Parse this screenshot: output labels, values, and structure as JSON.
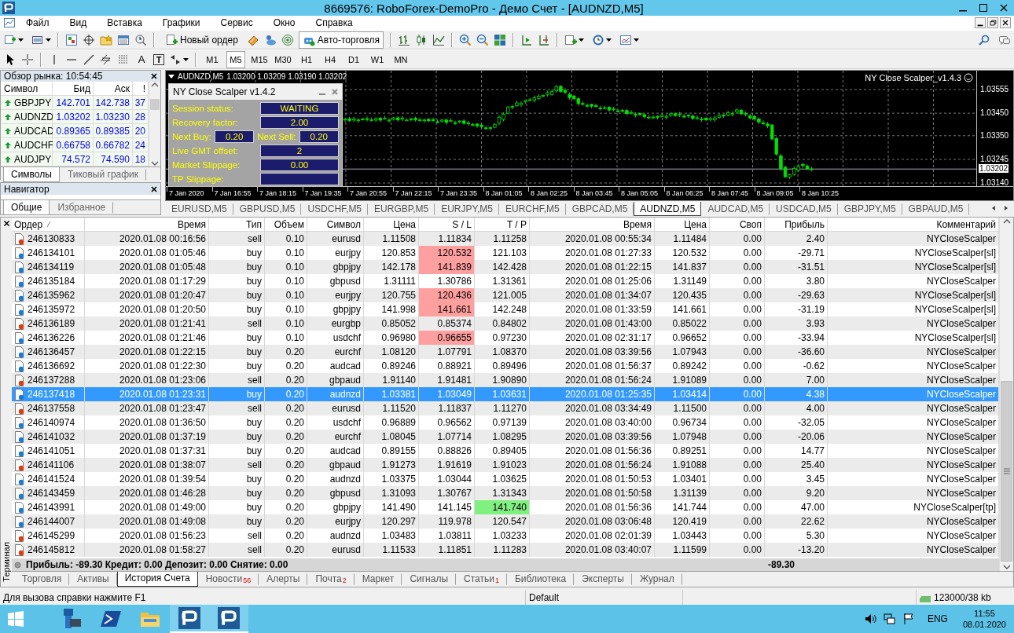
{
  "window": {
    "title": "8669576: RoboForex-DemoPro - Демо Счет - [AUDNZD,M5]"
  },
  "menu": [
    "Файл",
    "Вид",
    "Вставка",
    "Графики",
    "Сервис",
    "Окно",
    "Справка"
  ],
  "toolbar": {
    "new_order": "Новый ордер",
    "autotrading": {
      "label": "Авто-торговля",
      "on": true
    }
  },
  "drawing_tools": {
    "text_tool": "A",
    "text_label_tool": "T"
  },
  "timeframes": [
    {
      "label": "M1",
      "selected": false
    },
    {
      "label": "M5",
      "selected": true
    },
    {
      "label": "M15",
      "selected": false
    },
    {
      "label": "M30",
      "selected": false
    },
    {
      "label": "H1",
      "selected": false
    },
    {
      "label": "H4",
      "selected": false
    },
    {
      "label": "D1",
      "selected": false
    },
    {
      "label": "W1",
      "selected": false
    },
    {
      "label": "MN",
      "selected": false
    }
  ],
  "market_watch": {
    "title": "Обзор рынка: 10:54:45",
    "columns": [
      "Символ",
      "Бид",
      "Аск",
      "!"
    ],
    "rows": [
      {
        "symbol": "GBPJPY",
        "bid": "142.701",
        "ask": "142.738",
        "spread": "37"
      },
      {
        "symbol": "AUDNZD",
        "bid": "1.03202",
        "ask": "1.03230",
        "spread": "28"
      },
      {
        "symbol": "AUDCAD",
        "bid": "0.89365",
        "ask": "0.89385",
        "spread": "20"
      },
      {
        "symbol": "AUDCHF",
        "bid": "0.66758",
        "ask": "0.66782",
        "spread": "24"
      },
      {
        "symbol": "AUDJPY",
        "bid": "74.572",
        "ask": "74.590",
        "spread": "18"
      }
    ],
    "tabs": [
      {
        "label": "Символы",
        "selected": true
      },
      {
        "label": "Тиковый график",
        "selected": false
      }
    ]
  },
  "navigator": {
    "title": "Навигатор",
    "tabs": [
      {
        "label": "Общие",
        "selected": true
      },
      {
        "label": "Избранное",
        "selected": false
      }
    ]
  },
  "chart": {
    "symbol": "AUDNZD,M5",
    "ohlc": "1.03200 1.03209 1.03190 1.03202",
    "expert": "NY Close Scalper_v1.4.3",
    "price_labels": [
      "1.03555",
      "1.03450",
      "1.03350",
      "1.03245",
      "1.03140"
    ],
    "current_price": "1.03202",
    "time_labels": [
      "7 Jan 2020",
      "7 Jan 16:55",
      "7 Jan 18:15",
      "7 Jan 19:35",
      "7 Jan 20:55",
      "7 Jan 22:15",
      "7 Jan 23:35",
      "8 Jan 01:05",
      "8 Jan 02:25",
      "8 Jan 03:45",
      "8 Jan 05:05",
      "8 Jan 06:25",
      "8 Jan 07:45",
      "8 Jan 09:05",
      "8 Jan 10:25"
    ],
    "panel": {
      "title": "NY Close Scalper v1.4.2",
      "rows": [
        {
          "kind": "single",
          "label": "Session status:",
          "value": "WAITING"
        },
        {
          "kind": "single",
          "label": "Recovery factor:",
          "value": "2.00"
        },
        {
          "kind": "pair",
          "label": "Next Buy:",
          "value": "0.20",
          "label2": "Next Sell:",
          "value2": "0.20"
        },
        {
          "kind": "single",
          "label": "Live GMT offset:",
          "value": "2"
        },
        {
          "kind": "single",
          "label": "Market Slippage:",
          "value": "0.00"
        },
        {
          "kind": "single",
          "label": "TP Slippage:"
        }
      ]
    }
  },
  "chart_tabs": [
    {
      "label": "EURUSD,M5",
      "selected": false
    },
    {
      "label": "GBPUSD,M5",
      "selected": false
    },
    {
      "label": "USDCHF,M5",
      "selected": false
    },
    {
      "label": "EURGBP,M5",
      "selected": false
    },
    {
      "label": "EURJPY,M5",
      "selected": false
    },
    {
      "label": "EURCHF,M5",
      "selected": false
    },
    {
      "label": "GBPCAD,M5",
      "selected": false
    },
    {
      "label": "AUDNZD,M5",
      "selected": true
    },
    {
      "label": "AUDCAD,M5",
      "selected": false
    },
    {
      "label": "USDCAD,M5",
      "selected": false
    },
    {
      "label": "GBPJPY,M5",
      "selected": false
    },
    {
      "label": "GBPAUD,M5",
      "selected": false
    }
  ],
  "terminal": {
    "label": "Терминал",
    "columns": [
      "Ордер",
      "Время",
      "Тип",
      "Объем",
      "Символ",
      "Цена",
      "S / L",
      "T / P",
      "Время",
      "Цена",
      "Своп",
      "Прибыль",
      "Комментарий"
    ],
    "rows": [
      {
        "order": "246130833",
        "kind": "sell",
        "open_time": "2020.01.08 00:16:56",
        "type": "sell",
        "volume": "0.10",
        "symbol": "eurusd",
        "price": "1.11508",
        "sl": "1.11834",
        "tp": "1.11258",
        "close_time": "2020.01.08 00:55:34",
        "close_price": "1.11484",
        "swap": "0.00",
        "profit": "2.40",
        "comment": "NYCloseScalper",
        "sl_hit": false,
        "tp_hit": false,
        "selected": false
      },
      {
        "order": "246134101",
        "kind": "buy",
        "open_time": "2020.01.08 01:05:46",
        "type": "buy",
        "volume": "0.10",
        "symbol": "eurjpy",
        "price": "120.853",
        "sl": "120.532",
        "tp": "121.103",
        "close_time": "2020.01.08 01:27:33",
        "close_price": "120.532",
        "swap": "0.00",
        "profit": "-29.71",
        "comment": "NYCloseScalper[sl]",
        "sl_hit": true,
        "tp_hit": false,
        "selected": false
      },
      {
        "order": "246134119",
        "kind": "buy",
        "open_time": "2020.01.08 01:05:48",
        "type": "buy",
        "volume": "0.10",
        "symbol": "gbpjpy",
        "price": "142.178",
        "sl": "141.839",
        "tp": "142.428",
        "close_time": "2020.01.08 01:22:15",
        "close_price": "141.837",
        "swap": "0.00",
        "profit": "-31.51",
        "comment": "NYCloseScalper[sl]",
        "sl_hit": true,
        "tp_hit": false,
        "selected": false
      },
      {
        "order": "246135184",
        "kind": "buy",
        "open_time": "2020.01.08 01:17:29",
        "type": "buy",
        "volume": "0.10",
        "symbol": "gbpusd",
        "price": "1.31111",
        "sl": "1.30786",
        "tp": "1.31361",
        "close_time": "2020.01.08 01:25:06",
        "close_price": "1.31149",
        "swap": "0.00",
        "profit": "3.80",
        "comment": "NYCloseScalper",
        "sl_hit": false,
        "tp_hit": false,
        "selected": false
      },
      {
        "order": "246135962",
        "kind": "buy",
        "open_time": "2020.01.08 01:20:47",
        "type": "buy",
        "volume": "0.10",
        "symbol": "eurjpy",
        "price": "120.755",
        "sl": "120.436",
        "tp": "121.005",
        "close_time": "2020.01.08 01:34:07",
        "close_price": "120.435",
        "swap": "0.00",
        "profit": "-29.63",
        "comment": "NYCloseScalper[sl]",
        "sl_hit": true,
        "tp_hit": false,
        "selected": false
      },
      {
        "order": "246135972",
        "kind": "buy",
        "open_time": "2020.01.08 01:20:50",
        "type": "buy",
        "volume": "0.10",
        "symbol": "gbpjpy",
        "price": "141.998",
        "sl": "141.661",
        "tp": "142.248",
        "close_time": "2020.01.08 01:33:59",
        "close_price": "141.661",
        "swap": "0.00",
        "profit": "-31.19",
        "comment": "NYCloseScalper[sl]",
        "sl_hit": true,
        "tp_hit": false,
        "selected": false
      },
      {
        "order": "246136189",
        "kind": "sell",
        "open_time": "2020.01.08 01:21:41",
        "type": "sell",
        "volume": "0.10",
        "symbol": "eurgbp",
        "price": "0.85052",
        "sl": "0.85374",
        "tp": "0.84802",
        "close_time": "2020.01.08 01:43:00",
        "close_price": "0.85022",
        "swap": "0.00",
        "profit": "3.93",
        "comment": "NYCloseScalper",
        "sl_hit": false,
        "tp_hit": false,
        "selected": false
      },
      {
        "order": "246136226",
        "kind": "buy",
        "open_time": "2020.01.08 01:21:46",
        "type": "buy",
        "volume": "0.10",
        "symbol": "usdchf",
        "price": "0.96980",
        "sl": "0.96655",
        "tp": "0.97230",
        "close_time": "2020.01.08 02:31:17",
        "close_price": "0.96652",
        "swap": "0.00",
        "profit": "-33.94",
        "comment": "NYCloseScalper[sl]",
        "sl_hit": true,
        "tp_hit": false,
        "selected": false
      },
      {
        "order": "246136457",
        "kind": "buy",
        "open_time": "2020.01.08 01:22:15",
        "type": "buy",
        "volume": "0.20",
        "symbol": "eurchf",
        "price": "1.08120",
        "sl": "1.07791",
        "tp": "1.08370",
        "close_time": "2020.01.08 03:39:56",
        "close_price": "1.07943",
        "swap": "0.00",
        "profit": "-36.60",
        "comment": "NYCloseScalper",
        "sl_hit": false,
        "tp_hit": false,
        "selected": false
      },
      {
        "order": "246136692",
        "kind": "buy",
        "open_time": "2020.01.08 01:22:30",
        "type": "buy",
        "volume": "0.20",
        "symbol": "audcad",
        "price": "0.89246",
        "sl": "0.88921",
        "tp": "0.89496",
        "close_time": "2020.01.08 01:56:37",
        "close_price": "0.89242",
        "swap": "0.00",
        "profit": "-0.62",
        "comment": "NYCloseScalper",
        "sl_hit": false,
        "tp_hit": false,
        "selected": false
      },
      {
        "order": "246137288",
        "kind": "sell",
        "open_time": "2020.01.08 01:23:06",
        "type": "sell",
        "volume": "0.20",
        "symbol": "gbpaud",
        "price": "1.91140",
        "sl": "1.91481",
        "tp": "1.90890",
        "close_time": "2020.01.08 01:56:24",
        "close_price": "1.91089",
        "swap": "0.00",
        "profit": "7.00",
        "comment": "NYCloseScalper",
        "sl_hit": false,
        "tp_hit": false,
        "selected": false
      },
      {
        "order": "246137418",
        "kind": "buy",
        "open_time": "2020.01.08 01:23:31",
        "type": "buy",
        "volume": "0.20",
        "symbol": "audnzd",
        "price": "1.03381",
        "sl": "1.03049",
        "tp": "1.03631",
        "close_time": "2020.01.08 01:25:35",
        "close_price": "1.03414",
        "swap": "0.00",
        "profit": "4.38",
        "comment": "NYCloseScalper",
        "sl_hit": false,
        "tp_hit": false,
        "selected": true
      },
      {
        "order": "246137558",
        "kind": "sell",
        "open_time": "2020.01.08 01:23:47",
        "type": "sell",
        "volume": "0.20",
        "symbol": "eurusd",
        "price": "1.11520",
        "sl": "1.11837",
        "tp": "1.11270",
        "close_time": "2020.01.08 03:34:49",
        "close_price": "1.11500",
        "swap": "0.00",
        "profit": "4.00",
        "comment": "NYCloseScalper",
        "sl_hit": false,
        "tp_hit": false,
        "selected": false
      },
      {
        "order": "246140974",
        "kind": "buy",
        "open_time": "2020.01.08 01:36:50",
        "type": "buy",
        "volume": "0.20",
        "symbol": "usdchf",
        "price": "0.96889",
        "sl": "0.96562",
        "tp": "0.97139",
        "close_time": "2020.01.08 03:40:00",
        "close_price": "0.96734",
        "swap": "0.00",
        "profit": "-32.05",
        "comment": "NYCloseScalper",
        "sl_hit": false,
        "tp_hit": false,
        "selected": false
      },
      {
        "order": "246141032",
        "kind": "buy",
        "open_time": "2020.01.08 01:37:19",
        "type": "buy",
        "volume": "0.20",
        "symbol": "eurchf",
        "price": "1.08045",
        "sl": "1.07714",
        "tp": "1.08295",
        "close_time": "2020.01.08 03:39:56",
        "close_price": "1.07948",
        "swap": "0.00",
        "profit": "-20.06",
        "comment": "NYCloseScalper",
        "sl_hit": false,
        "tp_hit": false,
        "selected": false
      },
      {
        "order": "246141051",
        "kind": "buy",
        "open_time": "2020.01.08 01:37:31",
        "type": "buy",
        "volume": "0.20",
        "symbol": "audcad",
        "price": "0.89155",
        "sl": "0.88826",
        "tp": "0.89405",
        "close_time": "2020.01.08 01:56:36",
        "close_price": "0.89251",
        "swap": "0.00",
        "profit": "14.77",
        "comment": "NYCloseScalper",
        "sl_hit": false,
        "tp_hit": false,
        "selected": false
      },
      {
        "order": "246141106",
        "kind": "sell",
        "open_time": "2020.01.08 01:38:07",
        "type": "sell",
        "volume": "0.20",
        "symbol": "gbpaud",
        "price": "1.91273",
        "sl": "1.91619",
        "tp": "1.91023",
        "close_time": "2020.01.08 01:56:24",
        "close_price": "1.91088",
        "swap": "0.00",
        "profit": "25.40",
        "comment": "NYCloseScalper",
        "sl_hit": false,
        "tp_hit": false,
        "selected": false
      },
      {
        "order": "246141524",
        "kind": "buy",
        "open_time": "2020.01.08 01:39:54",
        "type": "buy",
        "volume": "0.20",
        "symbol": "audnzd",
        "price": "1.03375",
        "sl": "1.03044",
        "tp": "1.03625",
        "close_time": "2020.01.08 01:50:53",
        "close_price": "1.03401",
        "swap": "0.00",
        "profit": "3.45",
        "comment": "NYCloseScalper",
        "sl_hit": false,
        "tp_hit": false,
        "selected": false
      },
      {
        "order": "246143459",
        "kind": "buy",
        "open_time": "2020.01.08 01:46:28",
        "type": "buy",
        "volume": "0.20",
        "symbol": "gbpusd",
        "price": "1.31093",
        "sl": "1.30767",
        "tp": "1.31343",
        "close_time": "2020.01.08 01:50:58",
        "close_price": "1.31139",
        "swap": "0.00",
        "profit": "9.20",
        "comment": "NYCloseScalper",
        "sl_hit": false,
        "tp_hit": false,
        "selected": false
      },
      {
        "order": "246143991",
        "kind": "buy",
        "open_time": "2020.01.08 01:49:00",
        "type": "buy",
        "volume": "0.20",
        "symbol": "gbpjpy",
        "price": "141.490",
        "sl": "141.145",
        "tp": "141.740",
        "close_time": "2020.01.08 01:56:36",
        "close_price": "141.744",
        "swap": "0.00",
        "profit": "47.00",
        "comment": "NYCloseScalper[tp]",
        "sl_hit": false,
        "tp_hit": true,
        "selected": false
      },
      {
        "order": "246144007",
        "kind": "buy",
        "open_time": "2020.01.08 01:49:08",
        "type": "buy",
        "volume": "0.20",
        "symbol": "eurjpy",
        "price": "120.297",
        "sl": "119.978",
        "tp": "120.547",
        "close_time": "2020.01.08 03:06:48",
        "close_price": "120.419",
        "swap": "0.00",
        "profit": "22.62",
        "comment": "NYCloseScalper",
        "sl_hit": false,
        "tp_hit": false,
        "selected": false
      },
      {
        "order": "246145299",
        "kind": "sell",
        "open_time": "2020.01.08 01:56:23",
        "type": "sell",
        "volume": "0.20",
        "symbol": "audnzd",
        "price": "1.03483",
        "sl": "1.03811",
        "tp": "1.03233",
        "close_time": "2020.01.08 02:01:39",
        "close_price": "1.03443",
        "swap": "0.00",
        "profit": "5.30",
        "comment": "NYCloseScalper",
        "sl_hit": false,
        "tp_hit": false,
        "selected": false
      },
      {
        "order": "246145812",
        "kind": "sell",
        "open_time": "2020.01.08 01:58:27",
        "type": "sell",
        "volume": "0.20",
        "symbol": "eurusd",
        "price": "1.11533",
        "sl": "1.11851",
        "tp": "1.11283",
        "close_time": "2020.01.08 03:40:07",
        "close_price": "1.11599",
        "swap": "0.00",
        "profit": "-13.20",
        "comment": "NYCloseScalper",
        "sl_hit": false,
        "tp_hit": false,
        "selected": false
      }
    ],
    "summary": "Прибыль: -89.30  Кредит: 0.00  Депозит: 0.00  Снятие: 0.00",
    "total": "-89.30",
    "tabs": [
      {
        "label": "Торговля",
        "selected": false
      },
      {
        "label": "Активы",
        "selected": false
      },
      {
        "label": "История Счета",
        "selected": true
      },
      {
        "label": "Новости",
        "badge": "56",
        "selected": false
      },
      {
        "label": "Алерты",
        "selected": false
      },
      {
        "label": "Почта",
        "badge": "2",
        "selected": false
      },
      {
        "label": "Маркет",
        "selected": false
      },
      {
        "label": "Сигналы",
        "selected": false
      },
      {
        "label": "Статьи",
        "badge": "1",
        "selected": false
      },
      {
        "label": "Библиотека",
        "selected": false
      },
      {
        "label": "Эксперты",
        "selected": false
      },
      {
        "label": "Журнал",
        "selected": false
      }
    ]
  },
  "status_bar": {
    "help": "Для вызова справки нажмите F1",
    "profile": "Default",
    "traffic": "123000/38 kb"
  },
  "taskbar": {
    "language": "ENG",
    "time": "11:55",
    "date": "08.01.2020"
  }
}
